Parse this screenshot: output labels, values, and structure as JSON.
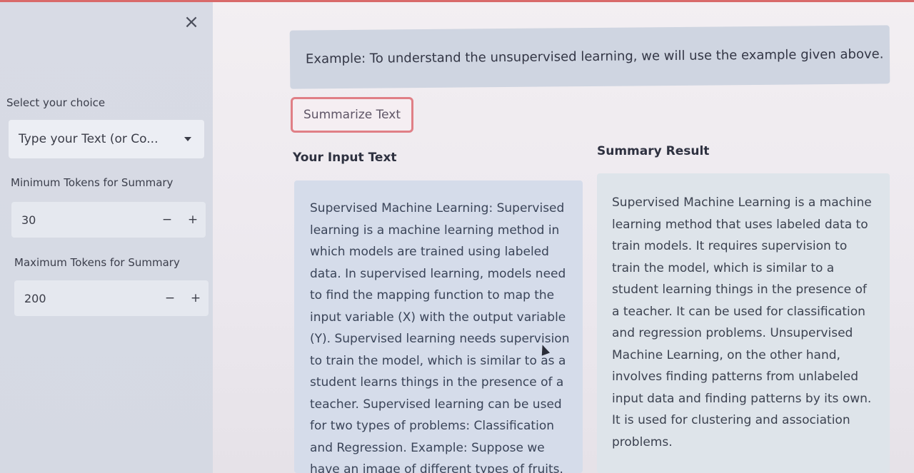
{
  "sidebar": {
    "close_label": "×",
    "choice_label": "Select your choice",
    "choice_value": "Type your Text (or Co...",
    "min_tokens_label": "Minimum Tokens for Summary",
    "min_tokens_value": "30",
    "max_tokens_label": "Maximum Tokens for Summary",
    "max_tokens_value": "200",
    "minus_label": "−",
    "plus_label": "+"
  },
  "main": {
    "info_text": "Example: To understand the unsupervised learning, we will use the example given above.",
    "summarize_button": "Summarize Text",
    "input_header": "Your Input Text",
    "result_header": "Summary Result",
    "input_lines": [
      "Supervised Machine Learning: Supervised",
      "learning is a machine learning method in",
      "which models are trained using labeled",
      "data. In supervised learning, models need",
      "to find the mapping function to map the",
      "input variable (X) with the output variable",
      "(Y). Supervised learning needs supervision",
      "to train the model, which is similar to as a",
      "student learns things in the presence of a",
      "teacher. Supervised learning can be used",
      "for two types of problems: Classification",
      "and Regression. Example: Suppose we",
      "have an image of different types of fruits."
    ],
    "result_lines": [
      "Supervised Machine Learning is a machine",
      "learning method that uses labeled data to",
      "train models. It requires supervision to",
      "train the model, which is similar to a",
      "student learning things in the presence of",
      "a teacher. It can be used for classification",
      "and regression problems. Unsupervised",
      "Machine Learning, on the other hand,",
      "involves finding patterns from unlabeled",
      "input data and finding patterns by its own.",
      "It is used for clustering and association",
      "problems."
    ]
  },
  "colors": {
    "accent_red": "#e07f86",
    "sidebar_bg": "#d8dbe5",
    "input_panel_bg": "#d5dcea"
  }
}
